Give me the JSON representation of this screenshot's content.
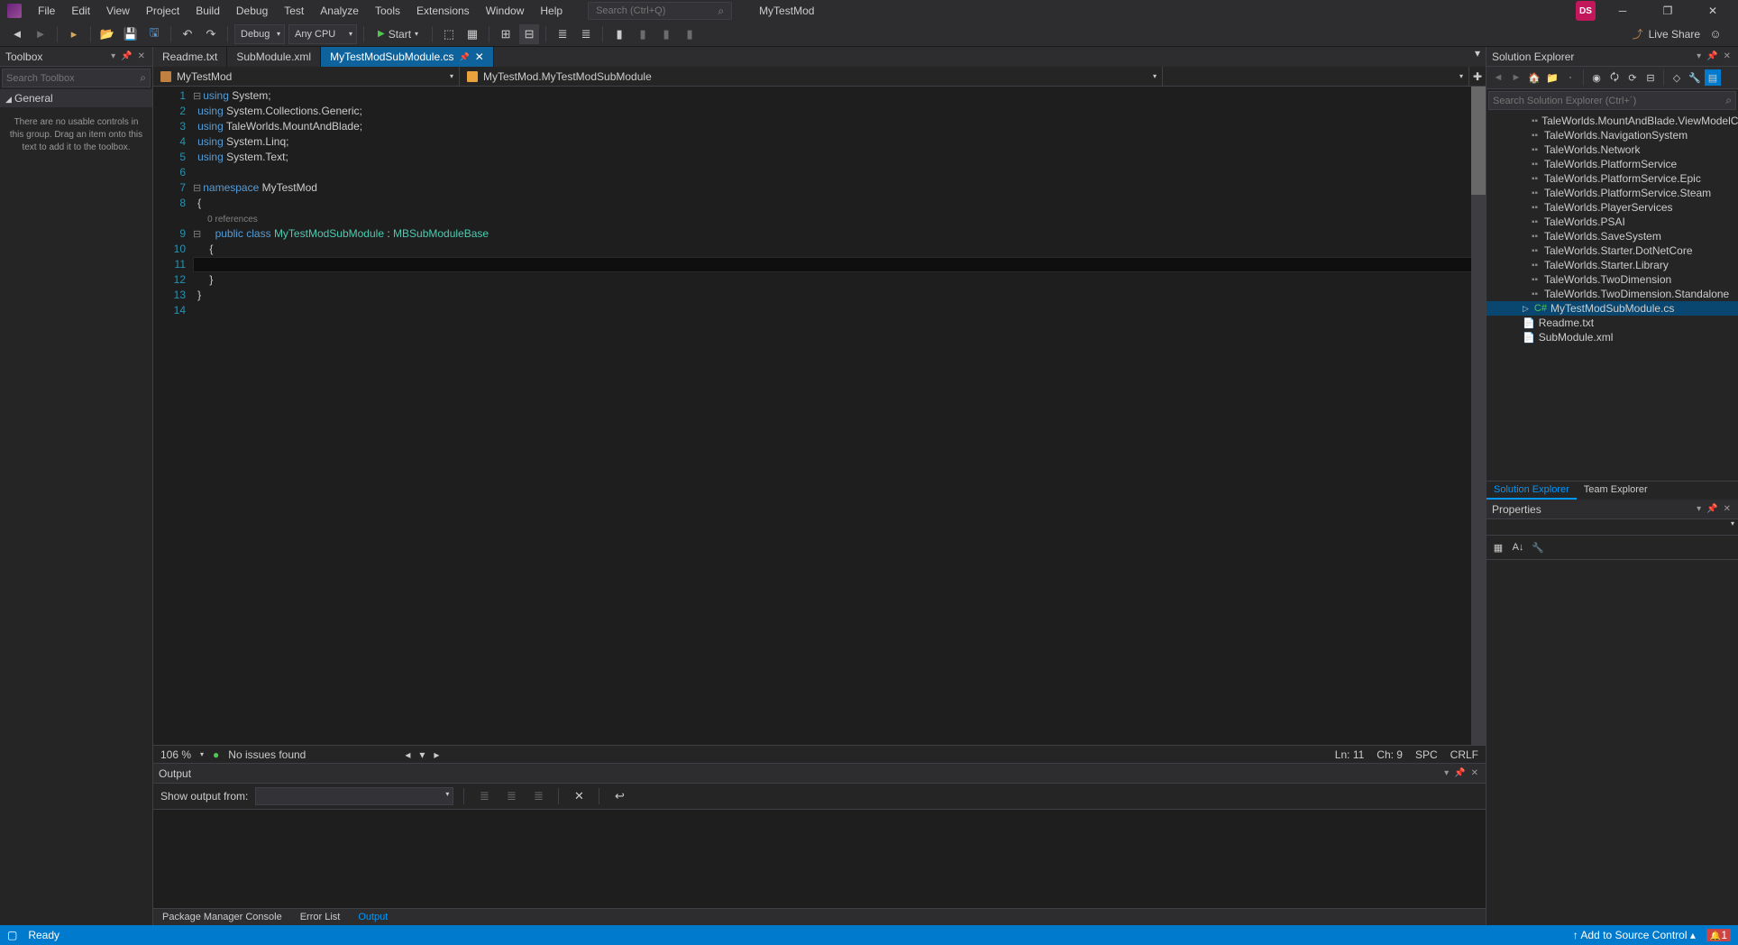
{
  "menu": [
    "File",
    "Edit",
    "View",
    "Project",
    "Build",
    "Debug",
    "Test",
    "Analyze",
    "Tools",
    "Extensions",
    "Window",
    "Help"
  ],
  "search_placeholder": "Search (Ctrl+Q)",
  "project_name": "MyTestMod",
  "avatar_initials": "DS",
  "toolbar": {
    "config": "Debug",
    "platform": "Any CPU",
    "start": "Start",
    "liveshare": "Live Share"
  },
  "toolbox": {
    "title": "Toolbox",
    "search_placeholder": "Search Toolbox",
    "general": "General",
    "message": "There are no usable controls in this group. Drag an item onto this text to add it to the toolbox."
  },
  "tabs": [
    {
      "label": "Readme.txt",
      "active": false
    },
    {
      "label": "SubModule.xml",
      "active": false
    },
    {
      "label": "MyTestModSubModule.cs",
      "active": true
    }
  ],
  "nav": {
    "left": "MyTestMod",
    "right": "MyTestMod.MyTestModSubModule"
  },
  "code": {
    "lines": [
      {
        "n": 1,
        "fold": "⊟",
        "tokens": [
          {
            "t": "using ",
            "c": "kw"
          },
          {
            "t": "System;",
            "c": ""
          }
        ]
      },
      {
        "n": 2,
        "tokens": [
          {
            "t": "using ",
            "c": "kw"
          },
          {
            "t": "System.Collections.Generic;",
            "c": ""
          }
        ]
      },
      {
        "n": 3,
        "tokens": [
          {
            "t": "using ",
            "c": "kw"
          },
          {
            "t": "TaleWorlds.MountAndBlade;",
            "c": ""
          }
        ]
      },
      {
        "n": 4,
        "tokens": [
          {
            "t": "using ",
            "c": "kw"
          },
          {
            "t": "System.Linq;",
            "c": ""
          }
        ]
      },
      {
        "n": 5,
        "tokens": [
          {
            "t": "using ",
            "c": "kw"
          },
          {
            "t": "System.Text;",
            "c": ""
          }
        ]
      },
      {
        "n": 6,
        "tokens": []
      },
      {
        "n": 7,
        "fold": "⊟",
        "tokens": [
          {
            "t": "namespace ",
            "c": "kw"
          },
          {
            "t": "MyTestMod",
            "c": ""
          }
        ]
      },
      {
        "n": 8,
        "tokens": [
          {
            "t": "{",
            "c": ""
          }
        ]
      },
      {
        "n": "",
        "tokens": [
          {
            "t": "    0 references",
            "c": "ref"
          }
        ]
      },
      {
        "n": 9,
        "fold": "⊟",
        "tokens": [
          {
            "t": "    ",
            "c": ""
          },
          {
            "t": "public ",
            "c": "kw"
          },
          {
            "t": "class ",
            "c": "kw"
          },
          {
            "t": "MyTestModSubModule",
            "c": "cls"
          },
          {
            "t": " : ",
            "c": ""
          },
          {
            "t": "MBSubModuleBase",
            "c": "cls"
          }
        ]
      },
      {
        "n": 10,
        "tokens": [
          {
            "t": "    {",
            "c": ""
          }
        ]
      },
      {
        "n": 11,
        "current": true,
        "tokens": [
          {
            "t": "        ",
            "c": ""
          }
        ]
      },
      {
        "n": 12,
        "tokens": [
          {
            "t": "    }",
            "c": ""
          }
        ]
      },
      {
        "n": 13,
        "tokens": [
          {
            "t": "}",
            "c": ""
          }
        ]
      },
      {
        "n": 14,
        "tokens": []
      }
    ]
  },
  "editor_status": {
    "zoom": "106 %",
    "issues": "No issues found",
    "ln": "Ln: 11",
    "ch": "Ch: 9",
    "spc": "SPC",
    "crlf": "CRLF"
  },
  "solution_explorer": {
    "title": "Solution Explorer",
    "search_placeholder": "Search Solution Explorer (Ctrl+´)",
    "items": [
      {
        "label": "TaleWorlds.MountAndBlade.ViewModelCollection",
        "icon": "ref"
      },
      {
        "label": "TaleWorlds.NavigationSystem",
        "icon": "ref"
      },
      {
        "label": "TaleWorlds.Network",
        "icon": "ref"
      },
      {
        "label": "TaleWorlds.PlatformService",
        "icon": "ref"
      },
      {
        "label": "TaleWorlds.PlatformService.Epic",
        "icon": "ref"
      },
      {
        "label": "TaleWorlds.PlatformService.Steam",
        "icon": "ref"
      },
      {
        "label": "TaleWorlds.PlayerServices",
        "icon": "ref"
      },
      {
        "label": "TaleWorlds.PSAI",
        "icon": "ref"
      },
      {
        "label": "TaleWorlds.SaveSystem",
        "icon": "ref"
      },
      {
        "label": "TaleWorlds.Starter.DotNetCore",
        "icon": "ref"
      },
      {
        "label": "TaleWorlds.Starter.Library",
        "icon": "ref"
      },
      {
        "label": "TaleWorlds.TwoDimension",
        "icon": "ref"
      },
      {
        "label": "TaleWorlds.TwoDimension.Standalone",
        "icon": "ref"
      },
      {
        "label": "MyTestModSubModule.cs",
        "icon": "cs",
        "level": 1,
        "selected": true,
        "arrow": true
      },
      {
        "label": "Readme.txt",
        "icon": "txt",
        "level": 1
      },
      {
        "label": "SubModule.xml",
        "icon": "txt",
        "level": 1
      }
    ],
    "tabs": [
      "Solution Explorer",
      "Team Explorer"
    ]
  },
  "properties": {
    "title": "Properties"
  },
  "output": {
    "title": "Output",
    "from_label": "Show output from:",
    "tabs": [
      "Package Manager Console",
      "Error List",
      "Output"
    ]
  },
  "statusbar": {
    "ready": "Ready",
    "source_control": "Add to Source Control",
    "notif": "1"
  }
}
